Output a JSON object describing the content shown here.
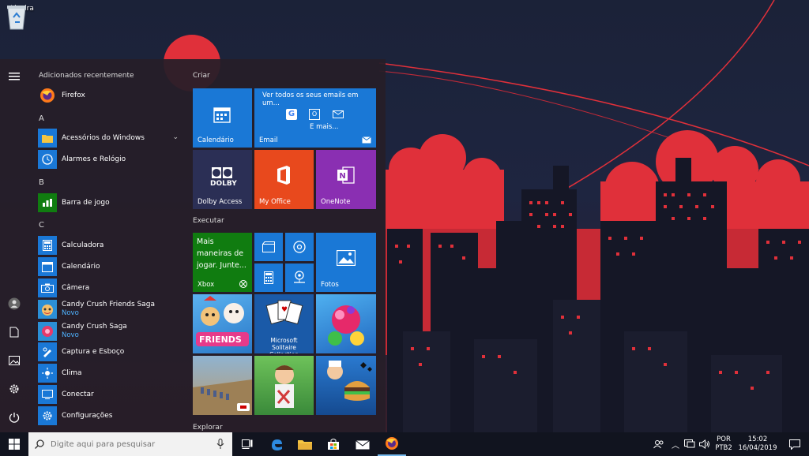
{
  "desktop": {
    "recycle_bin_label": "Lixeira"
  },
  "start_menu": {
    "recently_added_label": "Adicionados recentemente",
    "apps": [
      {
        "name": "Firefox",
        "icon": "firefox-icon"
      },
      {
        "letter": "A"
      },
      {
        "name": "Acessórios do Windows",
        "icon": "folder-icon"
      },
      {
        "name": "Alarmes e Relógio",
        "icon": "alarm-clock-icon"
      },
      {
        "letter": "B"
      },
      {
        "name": "Barra de jogo",
        "icon": "game-bar-icon"
      },
      {
        "letter": "C"
      },
      {
        "name": "Calculadora",
        "icon": "calculator-icon"
      },
      {
        "name": "Calendário",
        "icon": "calendar-icon"
      },
      {
        "name": "Câmera",
        "icon": "camera-icon"
      },
      {
        "name": "Candy Crush Friends Saga",
        "sub": "Novo",
        "icon": "candy-crush-friends-icon"
      },
      {
        "name": "Candy Crush Saga",
        "sub": "Novo",
        "icon": "candy-crush-icon"
      },
      {
        "name": "Captura e Esboço",
        "icon": "snip-sketch-icon"
      },
      {
        "name": "Clima",
        "icon": "weather-icon"
      },
      {
        "name": "Conectar",
        "icon": "connect-icon"
      },
      {
        "name": "Configurações",
        "icon": "settings-icon"
      }
    ],
    "groups": {
      "criar": "Criar",
      "executar": "Executar",
      "explorar": "Explorar"
    },
    "tiles": {
      "calendario": "Calendário",
      "email": "Email",
      "email_header": "Ver todos os seus emails em um...",
      "email_more": "E mais...",
      "dolby": "Dolby Access",
      "dolby_logo": "DOLBY",
      "office": "My Office",
      "onenote": "OneNote",
      "xbox": "Xbox",
      "xbox_text": "Mais maneiras de jogar. Junte...",
      "fotos": "Fotos",
      "solitaire": "Microsoft Solitaire Collection",
      "friends_text": "FRIENDS"
    }
  },
  "taskbar": {
    "search_placeholder": "Digite aqui para pesquisar",
    "lang_top": "POR",
    "lang_bottom": "PTB2",
    "time": "15:02",
    "date": "16/04/2019"
  },
  "colors": {
    "accent": "#1a78d6",
    "new_badge": "#4fb3ff",
    "office": "#e8491d",
    "onenote": "#8a2fb2",
    "xbox": "#107c10"
  }
}
